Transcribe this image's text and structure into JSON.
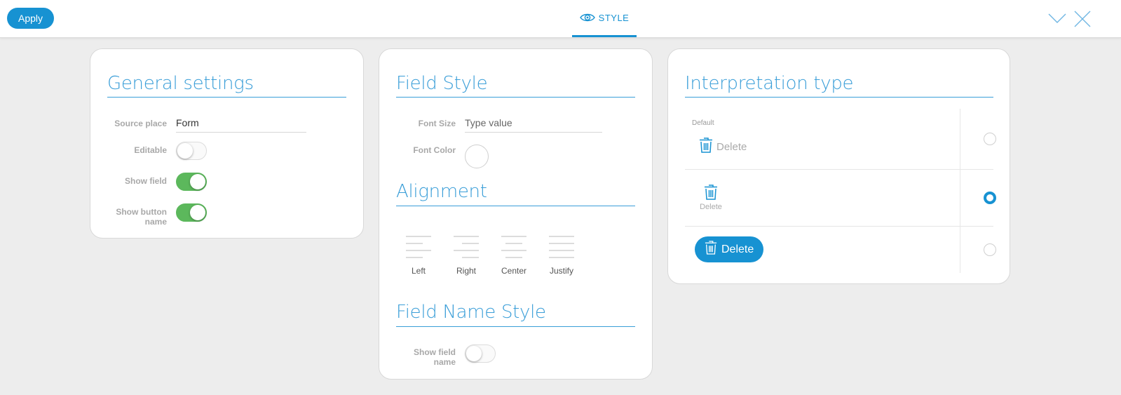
{
  "toolbar": {
    "apply_label": "Apply",
    "tab_label": "STYLE",
    "tab_icon": "eye-icon",
    "collapse_icon": "chevron-down-icon",
    "close_icon": "close-icon",
    "accent_color": "#1792d2"
  },
  "general_settings": {
    "title": "General settings",
    "source_place": {
      "label": "Source place",
      "value": "Form"
    },
    "editable": {
      "label": "Editable",
      "on": false
    },
    "show_field": {
      "label": "Show field",
      "on": true
    },
    "show_button_name": {
      "label_line1": "Show button",
      "label_line2": "name",
      "on": true
    }
  },
  "field_style": {
    "title": "Field Style",
    "font_size": {
      "label": "Font Size",
      "placeholder": "Type value"
    },
    "font_color": {
      "label": "Font Color"
    }
  },
  "alignment": {
    "title": "Alignment",
    "options": [
      {
        "label": "Left",
        "icon": "align-left-icon"
      },
      {
        "label": "Right",
        "icon": "align-right-icon"
      },
      {
        "label": "Center",
        "icon": "align-center-icon"
      },
      {
        "label": "Justify",
        "icon": "align-justify-icon"
      }
    ]
  },
  "field_name_style": {
    "title": "Field Name Style",
    "show_field_name": {
      "label_line1": "Show field",
      "label_line2": "name",
      "on": false
    }
  },
  "interpretation": {
    "title": "Interpretation type",
    "options": [
      {
        "caption": "Default",
        "label": "Delete",
        "style": "icon-text-inline",
        "selected": false
      },
      {
        "label": "Delete",
        "style": "icon-text-stacked",
        "selected": true
      },
      {
        "label": "Delete",
        "style": "button",
        "selected": false
      }
    ]
  }
}
